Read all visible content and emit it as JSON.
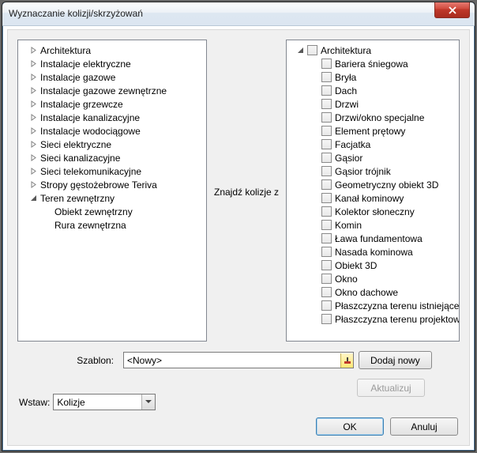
{
  "window": {
    "title": "Wyznaczanie kolizji/skrzyżowań"
  },
  "left_tree": [
    {
      "label": "Architektura",
      "expandable": true,
      "open": false
    },
    {
      "label": "Instalacje elektryczne",
      "expandable": true,
      "open": false
    },
    {
      "label": "Instalacje gazowe",
      "expandable": true,
      "open": false
    },
    {
      "label": "Instalacje gazowe zewnętrzne",
      "expandable": true,
      "open": false
    },
    {
      "label": "Instalacje grzewcze",
      "expandable": true,
      "open": false
    },
    {
      "label": "Instalacje kanalizacyjne",
      "expandable": true,
      "open": false
    },
    {
      "label": "Instalacje wodociągowe",
      "expandable": true,
      "open": false
    },
    {
      "label": "Sieci elektryczne",
      "expandable": true,
      "open": false
    },
    {
      "label": "Sieci kanalizacyjne",
      "expandable": true,
      "open": false
    },
    {
      "label": "Sieci telekomunikacyjne",
      "expandable": true,
      "open": false
    },
    {
      "label": "Stropy gęstożebrowe Teriva",
      "expandable": true,
      "open": false
    },
    {
      "label": "Teren zewnętrzny",
      "expandable": true,
      "open": true,
      "children": [
        {
          "label": "Obiekt zewnętrzny"
        },
        {
          "label": "Rura zewnętrzna"
        }
      ]
    }
  ],
  "middle_label": "Znajdź kolizje z",
  "right_tree": {
    "root": {
      "label": "Architektura"
    },
    "items": [
      "Bariera śniegowa",
      "Bryła",
      "Dach",
      "Drzwi",
      "Drzwi/okno specjalne",
      "Element prętowy",
      "Facjatka",
      "Gąsior",
      "Gąsior trójnik",
      "Geometryczny obiekt 3D",
      "Kanał kominowy",
      "Kolektor słoneczny",
      "Komin",
      "Ława fundamentowa",
      "Nasada kominowa",
      "Obiekt 3D",
      "Okno",
      "Okno dachowe",
      "Płaszczyzna terenu istniejącego",
      "Płaszczyzna terenu projektowa..."
    ]
  },
  "template": {
    "label": "Szablon:",
    "value": "<Nowy>"
  },
  "buttons": {
    "add": "Dodaj nowy",
    "update": "Aktualizuj",
    "ok": "OK",
    "cancel": "Anuluj"
  },
  "insert": {
    "label": "Wstaw:",
    "value": "Kolizje"
  }
}
